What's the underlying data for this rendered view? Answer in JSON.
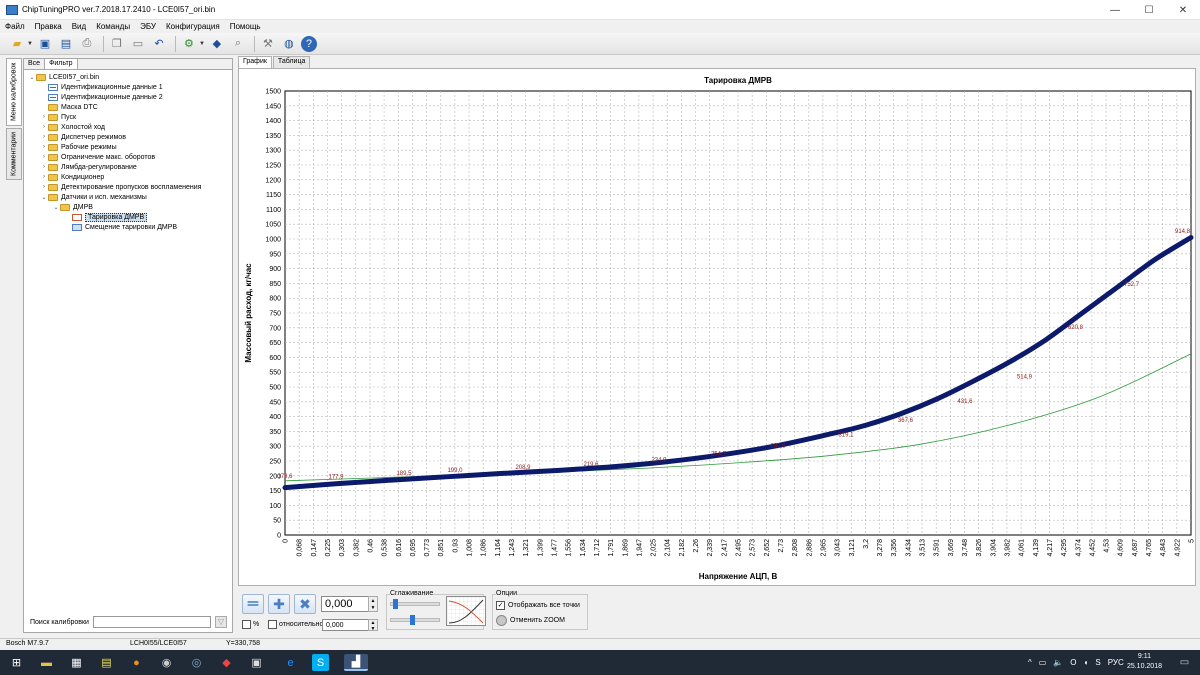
{
  "window": {
    "title": "ChipTuningPRO ver.7.2018.17.2410 - LCE0I57_ori.bin",
    "minimize_icon": "minimize-icon",
    "maximize_icon": "maximize-icon",
    "close_icon": "close-icon"
  },
  "menu": [
    "Файл",
    "Правка",
    "Вид",
    "Команды",
    "ЭБУ",
    "Конфигурация",
    "Помощь"
  ],
  "side_tabs": {
    "calibrations": "Меню калибровок",
    "comments": "Комментарии"
  },
  "filter_tabs": {
    "all": "Все",
    "filter": "Фильтр"
  },
  "tree": [
    {
      "label": "LCE0I57_ori.bin",
      "level": 0,
      "icon": "folder",
      "exp": "⌄"
    },
    {
      "label": "Идентификационные данные 1",
      "level": 1,
      "icon": "doc",
      "exp": ""
    },
    {
      "label": "Идентификационные данные 2",
      "level": 1,
      "icon": "doc",
      "exp": ""
    },
    {
      "label": "Маска DTC",
      "level": 1,
      "icon": "folder",
      "exp": ""
    },
    {
      "label": "Пуск",
      "level": 1,
      "icon": "folder",
      "exp": "›"
    },
    {
      "label": "Холостой ход",
      "level": 1,
      "icon": "folder",
      "exp": "›"
    },
    {
      "label": "Диспетчер режимов",
      "level": 1,
      "icon": "folder",
      "exp": "›"
    },
    {
      "label": "Рабочие режимы",
      "level": 1,
      "icon": "folder",
      "exp": "›"
    },
    {
      "label": "Ограничение макс. оборотов",
      "level": 1,
      "icon": "folder",
      "exp": "›"
    },
    {
      "label": "Лямбда-регулирование",
      "level": 1,
      "icon": "folder",
      "exp": "›"
    },
    {
      "label": "Кондиционер",
      "level": 1,
      "icon": "folder",
      "exp": "›"
    },
    {
      "label": "Детектирование пропусков воспламенения",
      "level": 1,
      "icon": "folder",
      "exp": "›"
    },
    {
      "label": "Датчики и исп. механизмы",
      "level": 1,
      "icon": "folder",
      "exp": "⌄"
    },
    {
      "label": "ДМРВ",
      "level": 2,
      "icon": "folder",
      "exp": "⌄"
    },
    {
      "label": "Тарировка ДМРВ",
      "level": 3,
      "icon": "graph",
      "exp": "",
      "selected": true
    },
    {
      "label": "Смещение тарировки ДМРВ",
      "level": 3,
      "icon": "num",
      "exp": ""
    }
  ],
  "search": {
    "label": "Поиск калибровки",
    "placeholder": ""
  },
  "view_tabs": {
    "graph": "График",
    "table": "Таблица"
  },
  "chart_data": {
    "type": "line",
    "title": "Тарировка ДМРВ",
    "xlabel": "Напряжение АЦП, В",
    "ylabel": "Массовый расход, кг/час",
    "xlim": [
      0,
      5
    ],
    "ylim": [
      0,
      1500
    ],
    "y_ticks": [
      0,
      50,
      100,
      150,
      200,
      250,
      300,
      350,
      400,
      450,
      500,
      550,
      600,
      650,
      700,
      750,
      800,
      850,
      900,
      950,
      1000,
      1050,
      1100,
      1150,
      1200,
      1250,
      1300,
      1350,
      1400,
      1450,
      1500
    ],
    "x_tick_labels": [
      "0",
      "0,068",
      "0,147",
      "0,225",
      "0,303",
      "0,382",
      "0,46",
      "0,538",
      "0,616",
      "0,695",
      "0,773",
      "0,851",
      "0,93",
      "1,008",
      "1,086",
      "1,164",
      "1,243",
      "1,321",
      "1,399",
      "1,477",
      "1,556",
      "1,634",
      "1,712",
      "1,791",
      "1,869",
      "1,947",
      "2,025",
      "2,104",
      "2,182",
      "2,26",
      "2,339",
      "2,417",
      "2,495",
      "2,573",
      "2,652",
      "2,73",
      "2,808",
      "2,886",
      "2,965",
      "3,043",
      "3,121",
      "3,2",
      "3,278",
      "3,356",
      "3,434",
      "3,513",
      "3,591",
      "3,669",
      "3,748",
      "3,826",
      "3,904",
      "3,982",
      "4,061",
      "4,139",
      "4,217",
      "4,295",
      "4,374",
      "4,452",
      "4,53",
      "4,609",
      "4,687",
      "4,765",
      "4,843",
      "4,922",
      "5"
    ],
    "series": [
      {
        "color": "#0c1a6b",
        "x": [
          0,
          0.3,
          0.6,
          0.9,
          1.2,
          1.5,
          1.8,
          2.1,
          2.4,
          2.7,
          3.0,
          3.2,
          3.4,
          3.6,
          3.8,
          4.0,
          4.2,
          4.4,
          4.6,
          4.8,
          5.0
        ],
        "y": [
          160,
          174,
          186,
          197,
          208,
          218,
          230,
          247,
          270,
          300,
          340,
          370,
          410,
          460,
          520,
          585,
          660,
          750,
          840,
          930,
          1005
        ]
      },
      {
        "color": "#2e9a3a",
        "x": [
          0,
          0.5,
          1.0,
          1.5,
          2.0,
          2.5,
          3.0,
          3.5,
          4.0,
          4.5,
          5.0
        ],
        "y": [
          183,
          193,
          203,
          213,
          226,
          244,
          268,
          306,
          372,
          468,
          612
        ]
      }
    ],
    "point_labels": [
      {
        "x": 0.0,
        "y": 178.6,
        "text": "178,6"
      },
      {
        "x": 0.3,
        "y": 177.9,
        "text": "177,9"
      },
      {
        "x": 0.7,
        "y": 189.5,
        "text": "189,5"
      },
      {
        "x": 1.0,
        "y": 199.0,
        "text": "199,0"
      },
      {
        "x": 1.4,
        "y": 208.9,
        "text": "208,9"
      },
      {
        "x": 1.8,
        "y": 219.6,
        "text": "219,6"
      },
      {
        "x": 2.2,
        "y": 234.9,
        "text": "234,9"
      },
      {
        "x": 2.55,
        "y": 254.7,
        "text": "254,7"
      },
      {
        "x": 2.9,
        "y": 282.6,
        "text": "282,6"
      },
      {
        "x": 3.3,
        "y": 319.1,
        "text": "319,1"
      },
      {
        "x": 3.65,
        "y": 367.6,
        "text": "367,6"
      },
      {
        "x": 4.0,
        "y": 431.6,
        "text": "431,6"
      },
      {
        "x": 4.35,
        "y": 514.9,
        "text": "514,9"
      },
      {
        "x": 4.65,
        "y": 620.8,
        "text": "620,8"
      },
      {
        "x": 4.98,
        "y": 752.7,
        "text": "752,7"
      },
      {
        "x": 5.28,
        "y": 914.8,
        "text": "914,8"
      }
    ],
    "grid": true,
    "legend": "none"
  },
  "bottom": {
    "value": "0,000",
    "percent_label": "%",
    "relative_label": "относительно",
    "relative_value": "0,000",
    "smoothing_label": "Сглаживание",
    "options_label": "Опции",
    "show_all_points_label": "Отображать все точки",
    "show_all_points_checked": true,
    "cancel_zoom_label": "Отменить ZOOM",
    "smooth_level_1": 0.05,
    "smooth_level_2": 0.42
  },
  "status": {
    "ecu": "Bosch M7.9.7",
    "file": "LCH0I55/LCE0I57",
    "coord": "Y=330,758"
  },
  "taskbar": {
    "language": "РУС",
    "time": "9:11",
    "date": "25.10.2018"
  }
}
